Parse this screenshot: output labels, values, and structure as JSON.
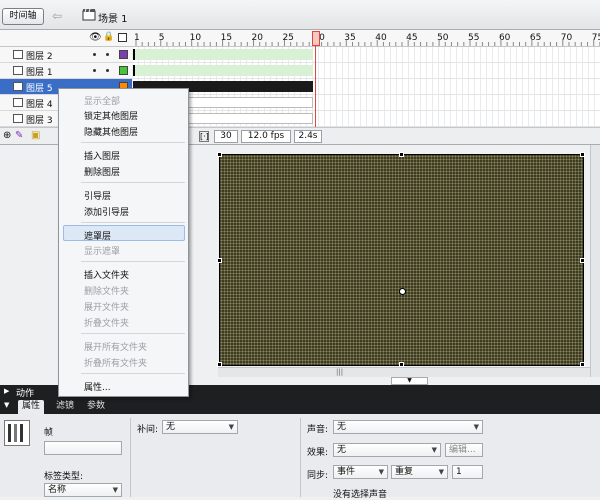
{
  "toolbar": {
    "timeline_btn": "时间轴",
    "scene": "场景 1"
  },
  "timeline": {
    "ruler": [
      "1",
      "5",
      "10",
      "15",
      "20",
      "25",
      "30",
      "35",
      "40",
      "45",
      "50",
      "55",
      "60",
      "65",
      "70",
      "75"
    ],
    "layers": [
      {
        "name": "图层 2",
        "color": "#7a3fb0",
        "selected": false
      },
      {
        "name": "图层 1",
        "color": "#46c43a",
        "selected": false
      },
      {
        "name": "图层 5",
        "color": "#ff8a00",
        "selected": true
      },
      {
        "name": "图层 4",
        "color": "#2d63c8",
        "selected": false
      },
      {
        "name": "图层 3",
        "color": "#1fb7b7",
        "selected": false
      }
    ],
    "frame": "30",
    "fps": "12.0 fps",
    "time": "2.4s"
  },
  "menu": [
    {
      "label": "显示全部",
      "disabled": true
    },
    {
      "label": "锁定其他图层",
      "disabled": false
    },
    {
      "label": "隐藏其他图层",
      "disabled": false
    },
    {
      "label": "插入图层",
      "disabled": false
    },
    {
      "label": "删除图层",
      "disabled": false
    },
    {
      "label": "引导层",
      "disabled": false
    },
    {
      "label": "添加引导层",
      "disabled": false
    },
    {
      "label": "遮罩层",
      "disabled": false,
      "highlight": true
    },
    {
      "label": "显示遮罩",
      "disabled": true
    },
    {
      "label": "插入文件夹",
      "disabled": false
    },
    {
      "label": "删除文件夹",
      "disabled": true
    },
    {
      "label": "展开文件夹",
      "disabled": true
    },
    {
      "label": "折叠文件夹",
      "disabled": true
    },
    {
      "label": "展开所有文件夹",
      "disabled": true
    },
    {
      "label": "折叠所有文件夹",
      "disabled": true
    },
    {
      "label": "属性...",
      "disabled": false
    }
  ],
  "panels": {
    "actions": "动作",
    "tabs": [
      "属性",
      "滤镜",
      "参数"
    ],
    "frame_label": "帧",
    "tween_label": "补间:",
    "tween_value": "无",
    "sound_label": "声音:",
    "sound_value": "无",
    "effect_label": "效果:",
    "effect_value": "无",
    "edit_btn": "编辑...",
    "sync_label": "同步:",
    "sync_value": "事件",
    "repeat_value": "重复",
    "repeat_count": "1",
    "label_type": "标签类型:",
    "label_type_value": "名称",
    "no_sound": "没有选择声音"
  },
  "colors": {
    "selected_row": "#3a6ec6",
    "playhead": "#e0463a",
    "stage": "#3d3b25"
  }
}
